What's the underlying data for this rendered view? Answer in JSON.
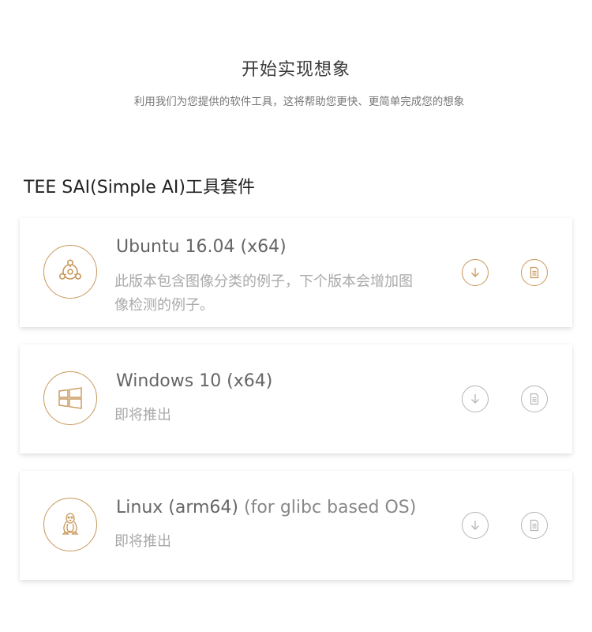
{
  "hero": {
    "title": "开始实现想象",
    "subtitle": "利用我们为您提供的软件工具，这将帮助您更快、更简单完成您的想象"
  },
  "section": {
    "title": "TEE SAI(Simple AI)工具套件"
  },
  "colors": {
    "accent": "#c8985a",
    "disabled": "#b5b5b5"
  },
  "cards": [
    {
      "logo_icon": "ubuntu-icon",
      "title": "Ubuntu 16.04 (x64)",
      "title_extra": "",
      "description": "此版本包含图像分类的例子，下个版本会增加图像检测的例子。",
      "download_icon": "download-icon",
      "doc_icon": "document-icon",
      "enabled": true
    },
    {
      "logo_icon": "windows-icon",
      "title": "Windows 10 (x64)",
      "title_extra": "",
      "description": "即将推出",
      "download_icon": "download-icon",
      "doc_icon": "document-icon",
      "enabled": false
    },
    {
      "logo_icon": "linux-tux-icon",
      "title": "Linux (arm64)",
      "title_extra": " (for glibc based OS)",
      "description": "即将推出",
      "download_icon": "download-icon",
      "doc_icon": "document-icon",
      "enabled": false
    }
  ]
}
